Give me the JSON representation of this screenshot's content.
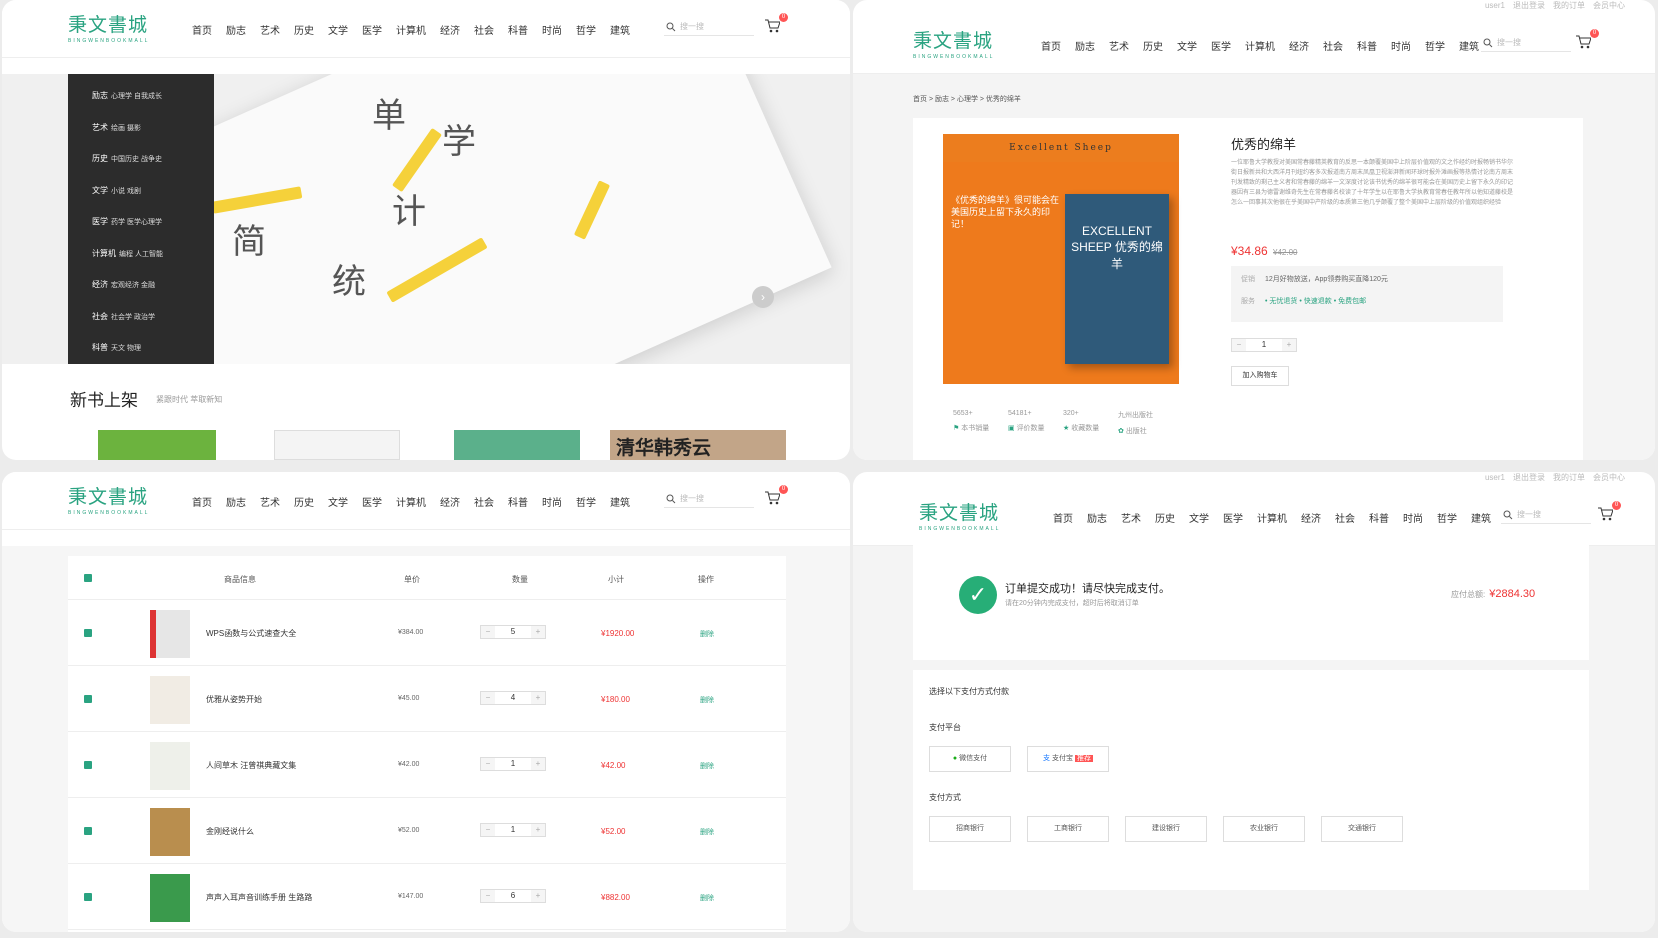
{
  "header": {
    "logo": "秉文書城",
    "logo_en": "BINGWENBOOKMALL",
    "nav": [
      "首页",
      "励志",
      "艺术",
      "历史",
      "文学",
      "医学",
      "计算机",
      "经济",
      "社会",
      "科普",
      "时尚",
      "哲学",
      "建筑"
    ],
    "search_placeholder": "搜一搜",
    "cart_count": "0",
    "topbar": [
      "user1",
      "退出登录",
      "我的订单",
      "会员中心"
    ]
  },
  "home": {
    "categories": [
      {
        "main": "励志",
        "sub": "心理学 自我成长"
      },
      {
        "main": "艺术",
        "sub": "绘画 摄影"
      },
      {
        "main": "历史",
        "sub": "中国历史 战争史"
      },
      {
        "main": "文学",
        "sub": "小说 戏剧"
      },
      {
        "main": "医学",
        "sub": "药学 医学心理学"
      },
      {
        "main": "计算机",
        "sub": "编程 人工智能"
      },
      {
        "main": "经济",
        "sub": "宏观经济 金融"
      },
      {
        "main": "社会",
        "sub": "社会学 政治学"
      },
      {
        "main": "科普",
        "sub": "天文 物理"
      }
    ],
    "banner_words": [
      "简",
      "统",
      "计",
      "学",
      "单"
    ],
    "new_title": "新书上架",
    "new_sub": "紧跟时代 萃取新知",
    "shelf_book4": "清华韩秀云"
  },
  "detail": {
    "breadcrumb": "首页 > 励志 > 心理学 > 优秀的绵羊",
    "cover_top": "Excellent Sheep",
    "cover_quote": "《优秀的绵羊》很可能会在美国历史上留下永久的印记！",
    "cover_spine": "EXCELLENT SHEEP 优秀的绵羊",
    "title": "优秀的绵羊",
    "desc": "一位耶鲁大学教授对美国常春藤精英教育的反思一本颠覆美国中上阶层价值观的文之作经约时报畅销书华尔街日报新共和大西洋月刊纽约客多次报道南方周末凤凰卫视澎湃新闻环球时报外滩画报等热情讨论南方周末刊发精致的剩己主义者和常春藤的绵羊一文深度讨论该书优秀的绵羊很可能会在美国历史上留下永久的印记器因有三县为德雷谢维奇先生在常春藤名校读了十年学生以在耶鲁大学执教育常春任教年所以他知道藤校是怎么一回事其次他很在乎美国中产阶级的本质第三他几乎颠覆了整个美国中上层阶级的价值观组织经验",
    "price": "¥34.86",
    "old_price": "¥42.00",
    "promo_label": "促销",
    "promo": "12月好物放送，App领券购买直降120元",
    "service_label": "服务",
    "services": [
      "• 无忧退货",
      "• 快速退款",
      "• 免费包邮"
    ],
    "qty": "1",
    "add_cart": "加入购物车",
    "stats": [
      {
        "v": "5653+",
        "l": "本书销量"
      },
      {
        "v": "54181+",
        "l": "评价数量"
      },
      {
        "v": "320+",
        "l": "收藏数量"
      },
      {
        "v": "九州出版社",
        "l": "出版社"
      }
    ]
  },
  "cart": {
    "headers": [
      "商品信息",
      "单价",
      "数量",
      "小计",
      "操作"
    ],
    "rows": [
      {
        "name": "WPS函数与公式速查大全",
        "price": "¥384.00",
        "qty": "5",
        "sub": "¥1920.00",
        "op": "删除"
      },
      {
        "name": "优雅从姿势开始",
        "price": "¥45.00",
        "qty": "4",
        "sub": "¥180.00",
        "op": "删除"
      },
      {
        "name": "人间草木 汪曾祺典藏文集",
        "price": "¥42.00",
        "qty": "1",
        "sub": "¥42.00",
        "op": "删除"
      },
      {
        "name": "金刚经说什么",
        "price": "¥52.00",
        "qty": "1",
        "sub": "¥52.00",
        "op": "删除"
      },
      {
        "name": "声声入耳声音训练手册 生路路",
        "price": "¥147.00",
        "qty": "6",
        "sub": "¥882.00",
        "op": "删除"
      }
    ]
  },
  "order": {
    "title": "订单提交成功！请尽快完成支付。",
    "sub": "请在20分钟内完成支付，超时后将取消订单",
    "amount_label": "应付总额:",
    "amount": "¥2884.30",
    "choose": "选择以下支付方式付款",
    "platform_label": "支付平台",
    "wechat": "微信支付",
    "alipay": "支付宝",
    "alipay_tag": "推荐",
    "method_label": "支付方式",
    "banks": [
      "招商银行",
      "工商银行",
      "建设银行",
      "农业银行",
      "交通银行"
    ]
  },
  "colors": {
    "accent": "#2aa381",
    "price": "#ee3333",
    "sidebar": "#2c2c2c"
  }
}
